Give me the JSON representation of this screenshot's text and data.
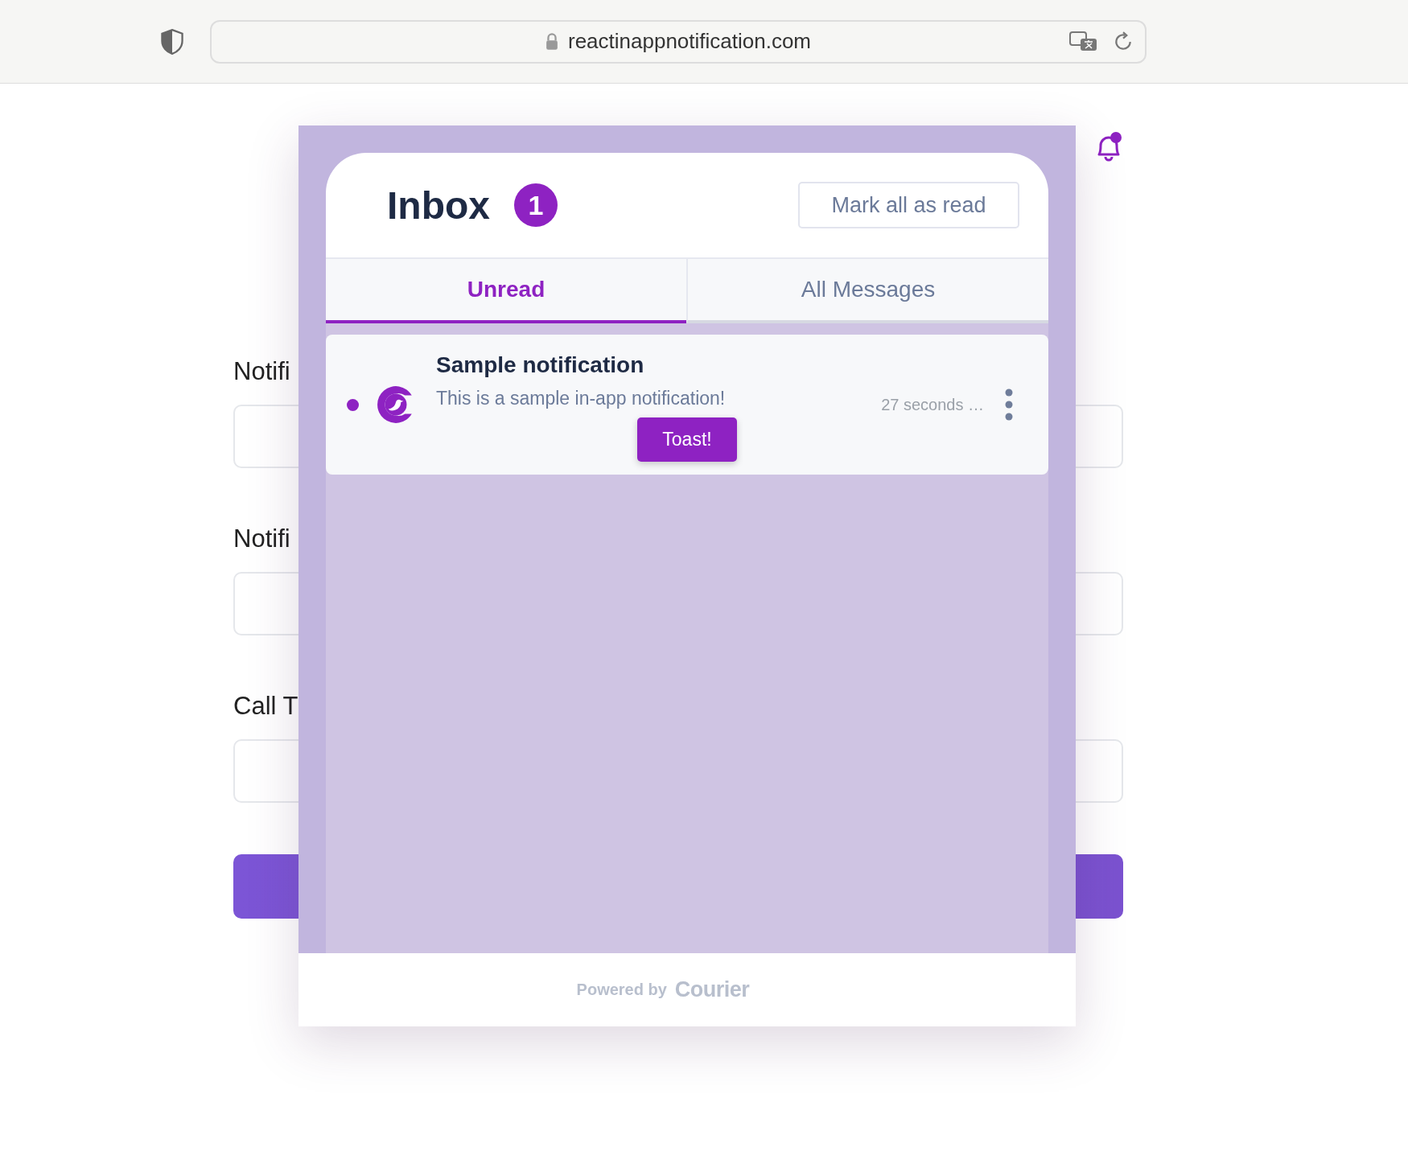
{
  "browser": {
    "url": "reactinappnotification.com"
  },
  "form": {
    "fields": [
      {
        "label": "Notifi"
      },
      {
        "label": "Notifi"
      },
      {
        "label": "Call T"
      }
    ]
  },
  "bell": {
    "has_unread": true
  },
  "inbox": {
    "title": "Inbox",
    "unread_count": "1",
    "mark_all_button": "Mark all as read",
    "tabs": [
      {
        "label": "Unread",
        "selected": true
      },
      {
        "label": "All Messages",
        "selected": false
      }
    ],
    "messages": [
      {
        "title": "Sample notification",
        "body": "This is a sample in-app notification!",
        "action": "Toast!",
        "time": "27 seconds …",
        "read": false
      }
    ],
    "footer": {
      "powered_by": "Powered by",
      "brand": "Courier"
    }
  }
}
